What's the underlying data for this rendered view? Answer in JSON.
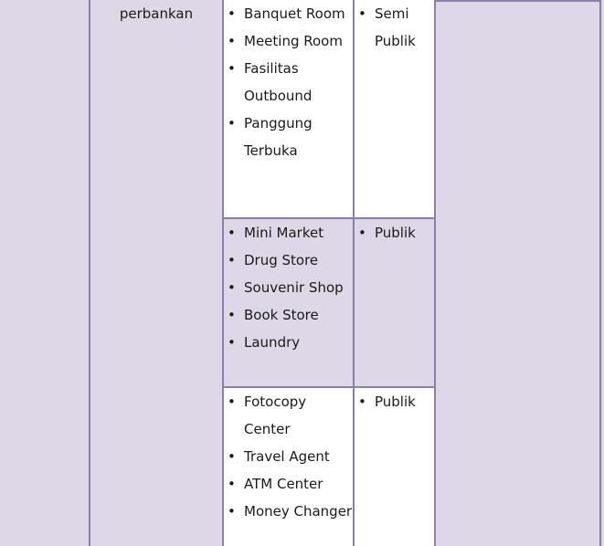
{
  "document": {
    "type": "table-fragment",
    "colors": {
      "cell_background_shaded": "#ddd7e8",
      "cell_background_plain": "#ffffff",
      "border": "#8b7faa",
      "text": "#1a1a1a"
    }
  },
  "table": {
    "columns": [
      {
        "name": "col-spacer-left",
        "label": ""
      },
      {
        "name": "col-category",
        "label": ""
      },
      {
        "name": "col-facility",
        "label": ""
      },
      {
        "name": "col-zone",
        "label": ""
      },
      {
        "name": "col-spacer-right",
        "label": ""
      }
    ],
    "rows": [
      {
        "id": "row-banquet",
        "shaded": false,
        "category": "perbankan",
        "facilities": [
          "Banquet Room",
          "Meeting Room",
          "Fasilitas Outbound",
          "Panggung Terbuka"
        ],
        "zone": "Semi Publik"
      },
      {
        "id": "row-retail",
        "shaded": true,
        "category": "",
        "facilities": [
          "Mini Market",
          "Drug Store",
          "Souvenir Shop",
          "Book Store",
          "Laundry"
        ],
        "zone": "Publik"
      },
      {
        "id": "row-services",
        "shaded": false,
        "category": "",
        "facilities": [
          "Fotocopy Center",
          "Travel Agent",
          "ATM Center",
          "Money Changer"
        ],
        "zone": "Publik"
      }
    ]
  }
}
